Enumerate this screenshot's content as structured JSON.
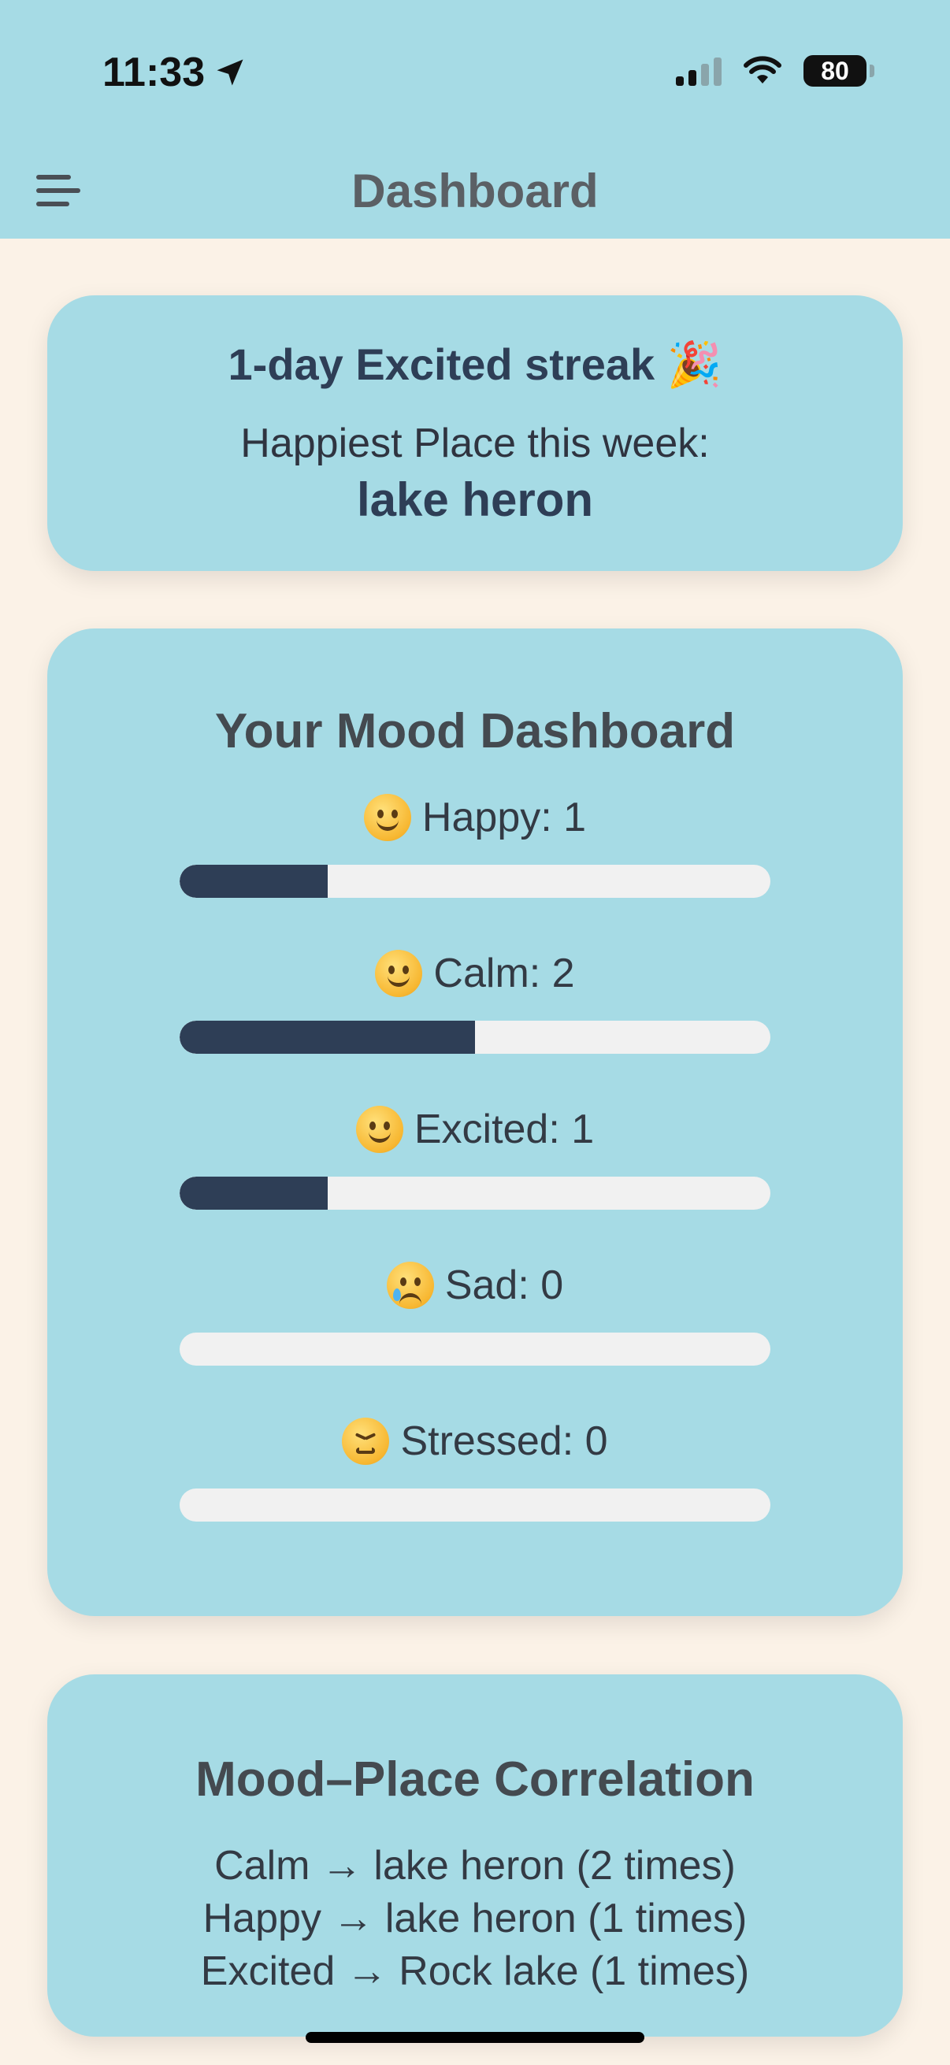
{
  "status_bar": {
    "time": "11:33",
    "battery": "80"
  },
  "header": {
    "title": "Dashboard"
  },
  "streak_card": {
    "title": "1-day Excited streak 🎉",
    "subtitle": "Happiest Place this week:",
    "place": "lake heron"
  },
  "mood_card": {
    "title": "Your Mood Dashboard",
    "moods": [
      {
        "label": "Happy: 1",
        "icon": "grinning-face-icon",
        "level": 0.25
      },
      {
        "label": "Calm: 2",
        "icon": "smiling-face-icon",
        "level": 0.5
      },
      {
        "label": "Excited: 1",
        "icon": "smiley-face-icon",
        "level": 0.25
      },
      {
        "label": "Sad: 0",
        "icon": "crying-face-icon",
        "level": 0
      },
      {
        "label": "Stressed: 0",
        "icon": "persevering-face-icon",
        "level": 0
      }
    ],
    "colors": {
      "bar_fill": "#2E3E56",
      "bar_track": "#F1F1F1"
    }
  },
  "correlation_card": {
    "title": "Mood–Place Correlation",
    "items": [
      "Calm → lake heron (2 times)",
      "Happy → lake heron (1 times)",
      "Excited → Rock lake (1 times)"
    ]
  },
  "colors": {
    "header_bg": "#A6DBE5",
    "card_bg": "#A6DBE5",
    "page_bg": "#FBF2E7",
    "accent_text": "#2E3E56"
  }
}
